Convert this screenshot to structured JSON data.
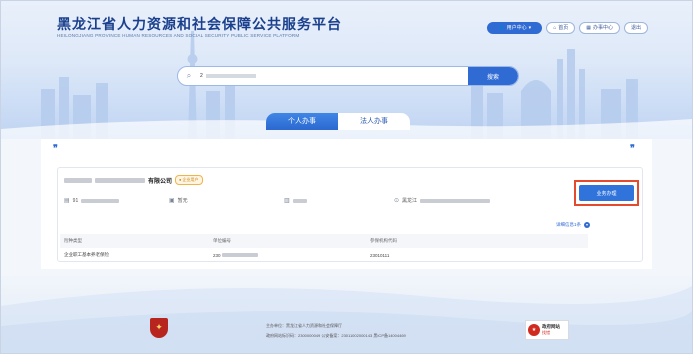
{
  "header": {
    "title": "黑龙江省人力资源和社会保障公共服务平台",
    "subtitle": "HEILONGJIANG PROVINCE HUMAN RESOURCES AND SOCIAL SECURITY PUBLIC SERVICE PLATFORM",
    "nav": {
      "user_center": "用户中心",
      "home": "首页",
      "service_center": "办事中心",
      "logout": "退出"
    }
  },
  "search": {
    "value": "2",
    "button": "搜索"
  },
  "tabs": [
    {
      "label": "个人办事"
    },
    {
      "label": "法人办事"
    }
  ],
  "company": {
    "name_suffix": "有限公司",
    "badge": "企业用户",
    "credit_code": "91",
    "phone": "暂无",
    "address_prefix": "黑龙江",
    "detail_link": "详细信息1条"
  },
  "table": {
    "headers": [
      "险种类型",
      "单位编号",
      "参保机构代码"
    ],
    "rows": [
      [
        "企业职工基本养老保险",
        "230",
        "23010111"
      ]
    ]
  },
  "business_button": "业务办理",
  "footer": {
    "line1": "主办单位：黑龙江省人力资源和社会保障厅",
    "line2": "政府网站标识码：2300000049 公安备案：23011002000143 黑ICP备14004469",
    "gov_label": "政府网站",
    "gov_sub": "找错"
  }
}
